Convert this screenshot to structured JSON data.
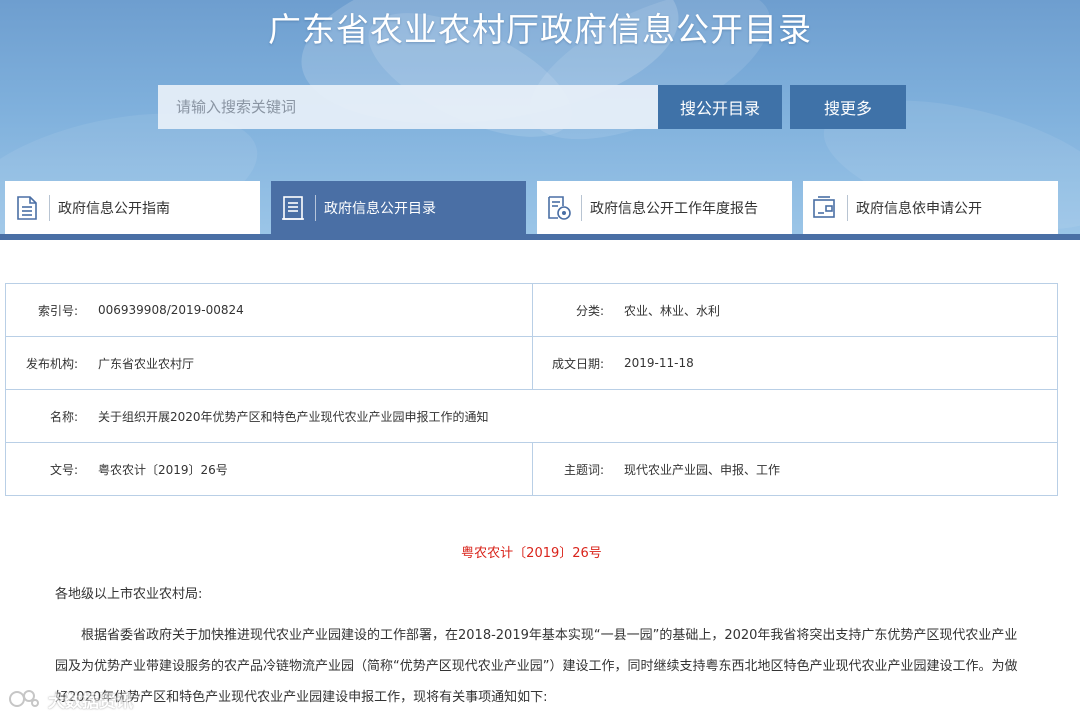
{
  "header": {
    "title": "广东省农业农村厅政府信息公开目录",
    "search_placeholder": "请输入搜索关键词",
    "search_button": "搜公开目录",
    "more_button": "搜更多"
  },
  "tabs": [
    {
      "label": "政府信息公开指南",
      "icon": "document-list-icon",
      "active": false
    },
    {
      "label": "政府信息公开目录",
      "icon": "catalog-icon",
      "active": true
    },
    {
      "label": "政府信息公开工作年度报告",
      "icon": "report-badge-icon",
      "active": false
    },
    {
      "label": "政府信息依申请公开",
      "icon": "application-form-icon",
      "active": false
    }
  ],
  "info": {
    "index_label": "索引号:",
    "index_value": "006939908/2019-00824",
    "category_label": "分类:",
    "category_value": "农业、林业、水利",
    "publisher_label": "发布机构:",
    "publisher_value": "广东省农业农村厅",
    "date_label": "成文日期:",
    "date_value": "2019-11-18",
    "name_label": "名称:",
    "name_value": "关于组织开展2020年优势产区和特色产业现代农业产业园申报工作的通知",
    "docno_label": "文号:",
    "docno_value": "粤农农计〔2019〕26号",
    "keywords_label": "主题词:",
    "keywords_value": "现代农业产业园、申报、工作"
  },
  "document": {
    "number": "粤农农计〔2019〕26号",
    "salutation": "各地级以上市农业农村局:",
    "paragraph": "根据省委省政府关于加快推进现代农业产业园建设的工作部署，在2018-2019年基本实现“一县一园”的基础上，2020年我省将突出支持广东优势产区现代农业产业园及为优势产业带建设服务的农产品冷链物流产业园（简称“优势产区现代农业产业园”）建设工作，同时继续支持粤东西北地区特色产业现代农业产业园建设工作。为做好2020年优势产区和特色产业现代农业产业园建设申报工作，现将有关事项通知如下:"
  },
  "watermark": {
    "text": "大数据资讯"
  },
  "colors": {
    "tab_active": "#4a6fa5",
    "button": "#3f72a8",
    "doc_number": "#d9241b",
    "table_border": "#b9cfe6"
  }
}
